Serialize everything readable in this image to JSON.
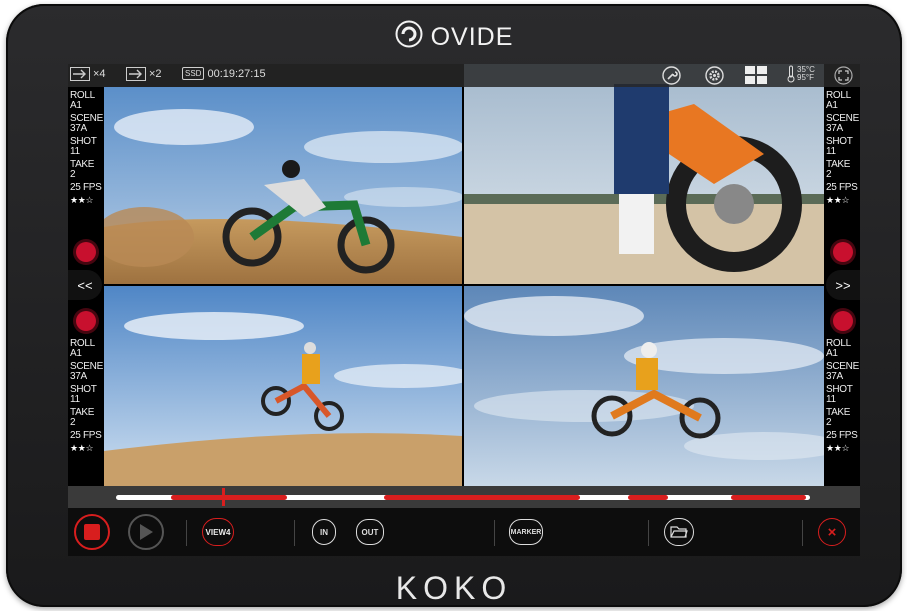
{
  "brand": {
    "top": "OVIDE",
    "bottom": "KOKO"
  },
  "topbar": {
    "out_a": "×4",
    "out_b": "×2",
    "ssd_label": "SSD",
    "timecode": "00:19:27:15",
    "temp_c": "35°C",
    "temp_f": "95°F"
  },
  "left_top": {
    "roll_label": "ROLL",
    "roll": "A1",
    "scene_label": "SCENE",
    "scene": "37A",
    "shot_label": "SHOT",
    "shot": "11",
    "take_label": "TAKE",
    "take": "2",
    "fps": "25 FPS",
    "stars": "★★☆"
  },
  "right_top": {
    "roll_label": "ROLL",
    "roll": "A1",
    "scene_label": "SCENE",
    "scene": "37A",
    "shot_label": "SHOT",
    "shot": "11",
    "take_label": "TAKE",
    "take": "2",
    "fps": "25 FPS",
    "stars": "★★☆"
  },
  "left_bottom": {
    "roll_label": "ROLL",
    "roll": "A1",
    "scene_label": "SCENE",
    "scene": "37A",
    "shot_label": "SHOT",
    "shot": "11",
    "take_label": "TAKE",
    "take": "2",
    "fps": "25 FPS",
    "stars": "★★☆"
  },
  "right_bottom": {
    "roll_label": "ROLL",
    "roll": "A1",
    "scene_label": "SCENE",
    "scene": "37A",
    "shot_label": "SHOT",
    "shot": "11",
    "take_label": "TAKE",
    "take": "2",
    "fps": "25 FPS",
    "stars": "★★☆"
  },
  "nav": {
    "prev": "<<",
    "next": ">>"
  },
  "controls": {
    "view": "VIEW4",
    "in": "IN",
    "out": "OUT",
    "marker": "MARKER"
  },
  "colors": {
    "accent": "#d81e1e",
    "bezel": "#1f1f20"
  },
  "icons": [
    "export-icon",
    "export-icon",
    "ssd-icon",
    "wrench-icon",
    "gear-icon",
    "grid-icon",
    "thermometer-icon",
    "fullscreen-icon",
    "record-icon",
    "play-icon",
    "folder-icon",
    "close-icon"
  ]
}
